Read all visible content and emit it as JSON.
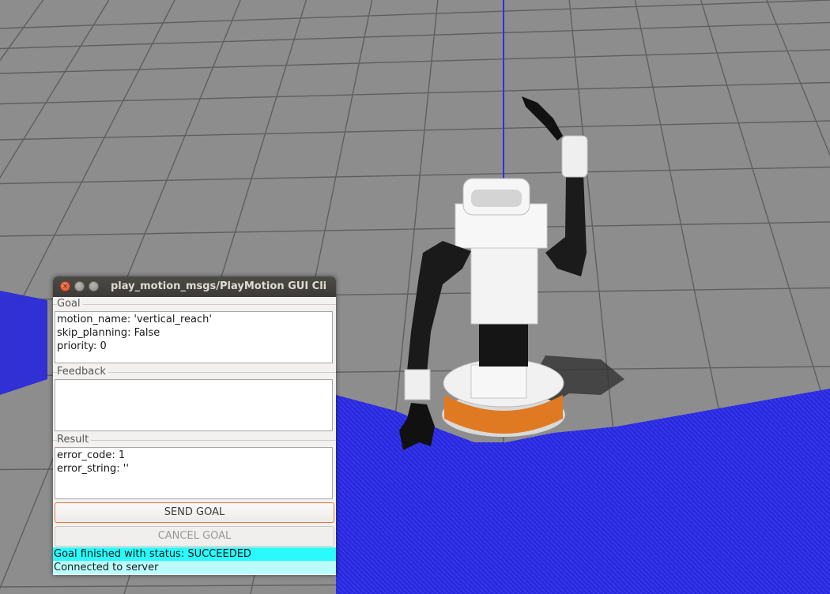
{
  "window": {
    "title": "play_motion_msgs/PlayMotion GUI Cli",
    "close_glyph": "×",
    "min_glyph": "–",
    "max_glyph": "□"
  },
  "goal": {
    "label": "Goal",
    "lines": [
      "motion_name: 'vertical_reach'",
      "skip_planning: False",
      "priority: 0"
    ]
  },
  "feedback": {
    "label": "Feedback",
    "lines": []
  },
  "result": {
    "label": "Result",
    "lines": [
      "error_code: 1",
      "error_string: ''"
    ]
  },
  "buttons": {
    "send_goal": "SEND GOAL",
    "cancel_goal": "CANCEL GOAL"
  },
  "status": {
    "goal_status": "Goal finished with status: SUCCEEDED",
    "connection": "Connected to server"
  },
  "colors": {
    "sky": "#8e8e8e",
    "grid_line": "#5f5f5f",
    "laser": "#2626e6",
    "status_active": "#2afafc",
    "status_info": "#bafcfc",
    "send_border": "#e6763a",
    "robot_black": "#141414",
    "robot_white": "#f1f1f1",
    "robot_orange": "#e07a22"
  }
}
